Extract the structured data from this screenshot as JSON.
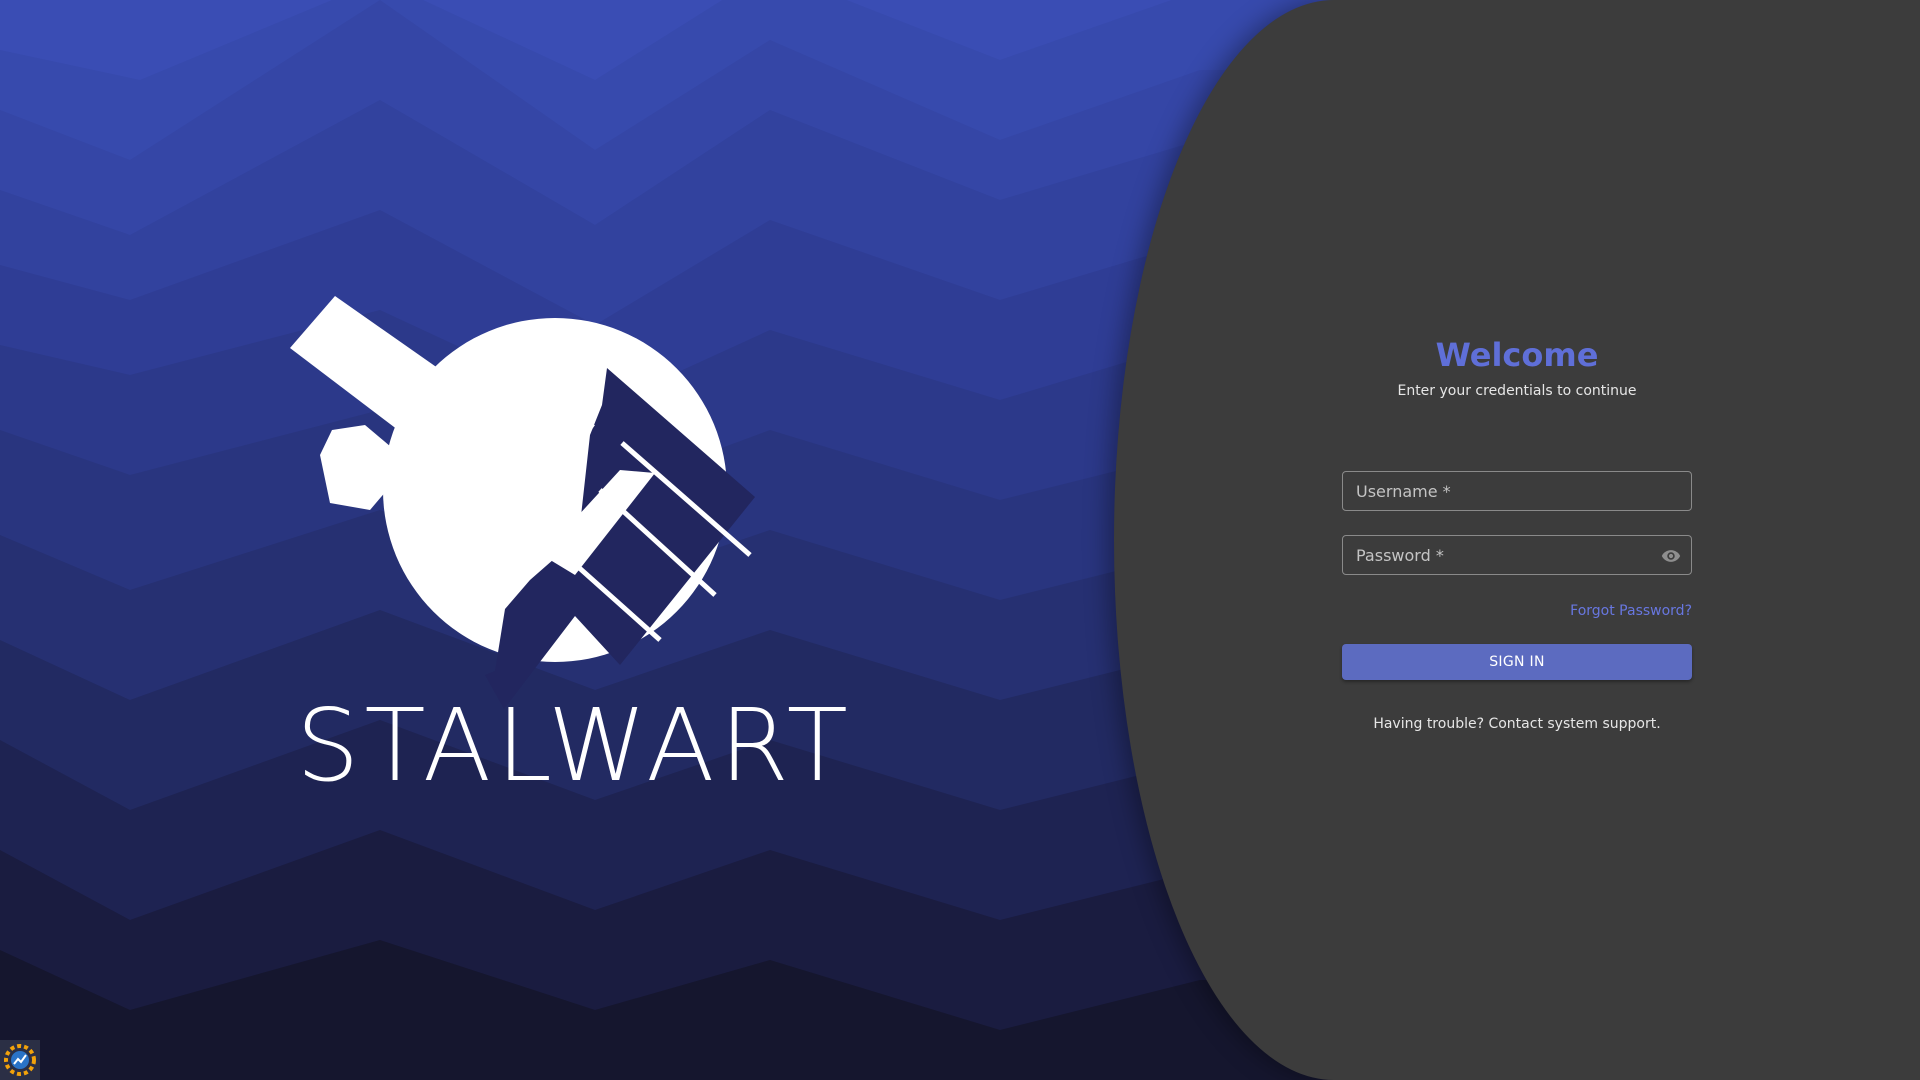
{
  "brand": {
    "name": "STALWART"
  },
  "login": {
    "title": "Welcome",
    "subtitle": "Enter your credentials to continue",
    "username_placeholder": "Username *",
    "password_placeholder": "Password *",
    "forgot_label": "Forgot Password?",
    "signin_label": "SIGN IN",
    "trouble_text": "Having trouble? Contact system support."
  },
  "icons": {
    "password_toggle": "eye-icon",
    "corner_badge": "gear-chart-icon",
    "logo": "satellite-globe-logo"
  },
  "colors": {
    "accent": "#5c6bc0",
    "panel": "#3c3c3c",
    "background_top": "#3a4db4",
    "background_bottom": "#10101a"
  }
}
